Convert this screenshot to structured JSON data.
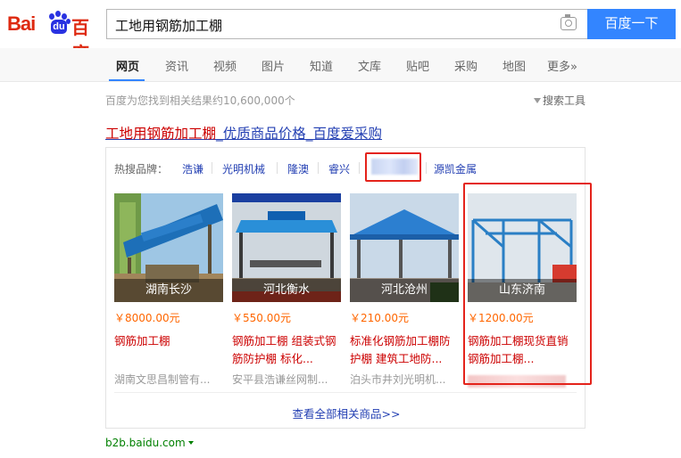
{
  "logo": {
    "text_bai": "Bai",
    "text_du_paw": "du",
    "text_baidu_cn": "百度"
  },
  "search": {
    "query": "工地用钢筋加工棚",
    "button": "百度一下"
  },
  "nav": {
    "items": [
      "网页",
      "资讯",
      "视频",
      "图片",
      "知道",
      "文库",
      "贴吧",
      "采购",
      "地图",
      "更多»"
    ],
    "active": "网页"
  },
  "results": {
    "count_text": "百度为您找到相关结果约10,600,000个",
    "tools": "搜索工具"
  },
  "ad": {
    "title_highlight": "工地用钢筋加工棚",
    "title_rest": "_优质商品价格_百度爱采购",
    "brands_label": "热搜品牌：",
    "brands": [
      "浩谦",
      "光明机械",
      "隆澳",
      "睿兴",
      "源凯金属"
    ],
    "products": [
      {
        "city": "湖南长沙",
        "price": "￥8000.00元",
        "name": "钢筋加工棚",
        "seller": "湖南文思昌制管有..."
      },
      {
        "city": "河北衡水",
        "price": "￥550.00元",
        "name": "钢筋加工棚 组装式钢筋防护棚 标化...",
        "seller": "安平县浩谦丝网制..."
      },
      {
        "city": "河北沧州",
        "price": "￥210.00元",
        "name": "标准化钢筋加工棚防护棚 建筑工地防...",
        "seller": "泊头市井刘光明机..."
      },
      {
        "city": "山东济南",
        "price": "￥1200.00元",
        "name": "钢筋加工棚现货直销 钢筋加工棚...",
        "seller": ""
      }
    ],
    "view_all": "查看全部相关商品>>"
  },
  "site_url": "b2b.baidu.com",
  "colors": {
    "brand_red": "#de2910",
    "brand_blue": "#2932e1",
    "search_btn": "#3385ff",
    "link": "#2440b3",
    "price": "#ff6600",
    "annotation_red": "#e4231b"
  }
}
